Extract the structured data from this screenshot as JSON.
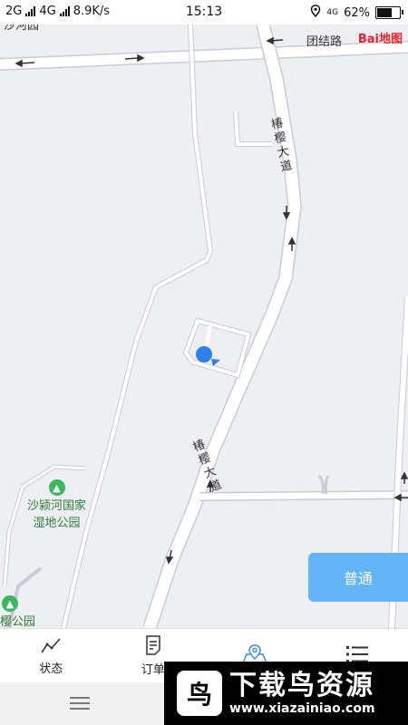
{
  "status_bar": {
    "network_1": "2G",
    "network_2": "4G",
    "speed": "8.9K/s",
    "time": "15:13",
    "volte": "4G",
    "battery": "62%",
    "battery_level": 0.62
  },
  "map": {
    "top_left_fragment": "沙河园",
    "road_label_top": "团结路",
    "baidu_logo": "Bai地图",
    "road_name_upper": "椿樱大道",
    "road_name_lower": "椿樱大道",
    "park_1_line1": "沙颍河国家",
    "park_1_line2": "湿地公园",
    "park_2": "樱公园",
    "location_marker": "location-dot"
  },
  "mode_button": {
    "label": "普通"
  },
  "tabs": [
    {
      "label": "状态",
      "icon": "trend-line-icon"
    },
    {
      "label": "订单",
      "icon": "document-icon"
    },
    {
      "label": "",
      "icon": "map-pin-icon"
    },
    {
      "label": "",
      "icon": "list-icon"
    }
  ],
  "watermark": {
    "title": "下载鸟资源",
    "url": "www.xiazainiao.com"
  },
  "colors": {
    "accent": "#64b5f7",
    "map_bg": "#eeeff3",
    "road": "#ffffff",
    "road_edge": "#c9ccd4",
    "active_tab": "#3a8fd6"
  }
}
